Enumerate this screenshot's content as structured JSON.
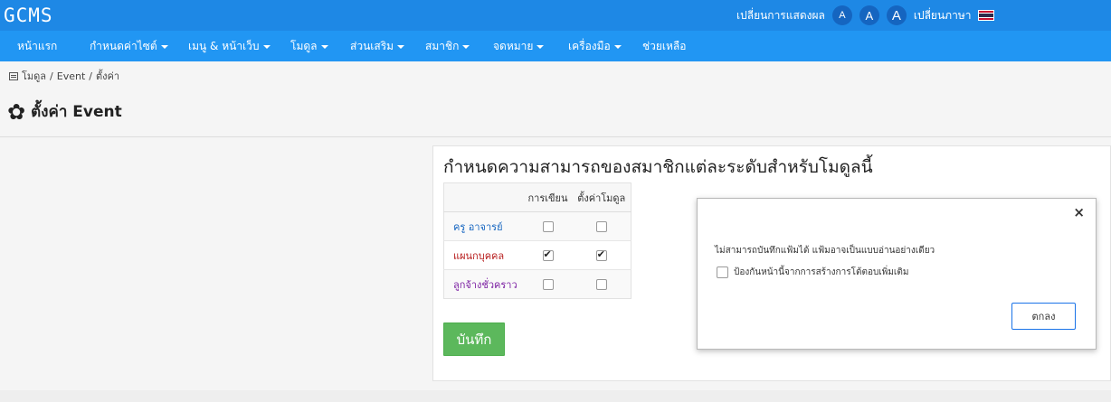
{
  "app": {
    "logo": "GCMS"
  },
  "topbar": {
    "change_display": "เปลี่ยนการแสดงผล",
    "font_small": "A",
    "font_medium": "A",
    "font_large": "A",
    "change_language": "เปลี่ยนภาษา",
    "flag_icon": "thai-flag-icon",
    "colors": {
      "bar": "#1e88e5",
      "nav": "#2196f3"
    }
  },
  "nav": {
    "items": [
      {
        "label": "หน้าแรก",
        "dropdown": false
      },
      {
        "label": "กำหนดค่าไซต์",
        "dropdown": true
      },
      {
        "label": "เมนู & หน้าเว็บ",
        "dropdown": true
      },
      {
        "label": "โมดูล",
        "dropdown": true
      },
      {
        "label": "ส่วนเสริม",
        "dropdown": true
      },
      {
        "label": "สมาชิก",
        "dropdown": true
      },
      {
        "label": "จดหมาย",
        "dropdown": true
      },
      {
        "label": "เครื่องมือ",
        "dropdown": true
      },
      {
        "label": "ช่วยเหลือ",
        "dropdown": false
      }
    ]
  },
  "breadcrumb": {
    "icon": "module-icon",
    "items": [
      "โมดูล",
      "/",
      "Event",
      "/",
      "ตั้งค่า"
    ]
  },
  "page": {
    "title": "ตั้งค่า Event",
    "icon": "gear-icon"
  },
  "permissions": {
    "heading": "กำหนดความสามารถของสมาชิกแต่ละระดับสำหรับโมดูลนี้",
    "columns": [
      "",
      "การเขียน",
      "ตั้งค่าโมดูล"
    ],
    "rows": [
      {
        "role": "ครู อาจารย์",
        "write": false,
        "config": false
      },
      {
        "role": "แผนกบุคคล",
        "write": true,
        "config": true
      },
      {
        "role": "ลูกจ้างชั่วคราว",
        "write": false,
        "config": false
      }
    ],
    "save_label": "บันทึก",
    "save_color": "#5cb85c"
  },
  "dialog": {
    "close_symbol": "×",
    "message": "ไม่สามารถบันทึกแฟ้มได้ แฟ้มอาจเป็นแบบอ่านอย่างเดียว",
    "checkbox_label": "ป้องกันหน้านี้จากการสร้างการโต้ตอบเพิ่มเติม",
    "checkbox_checked": false,
    "ok_label": "ตกลง"
  }
}
